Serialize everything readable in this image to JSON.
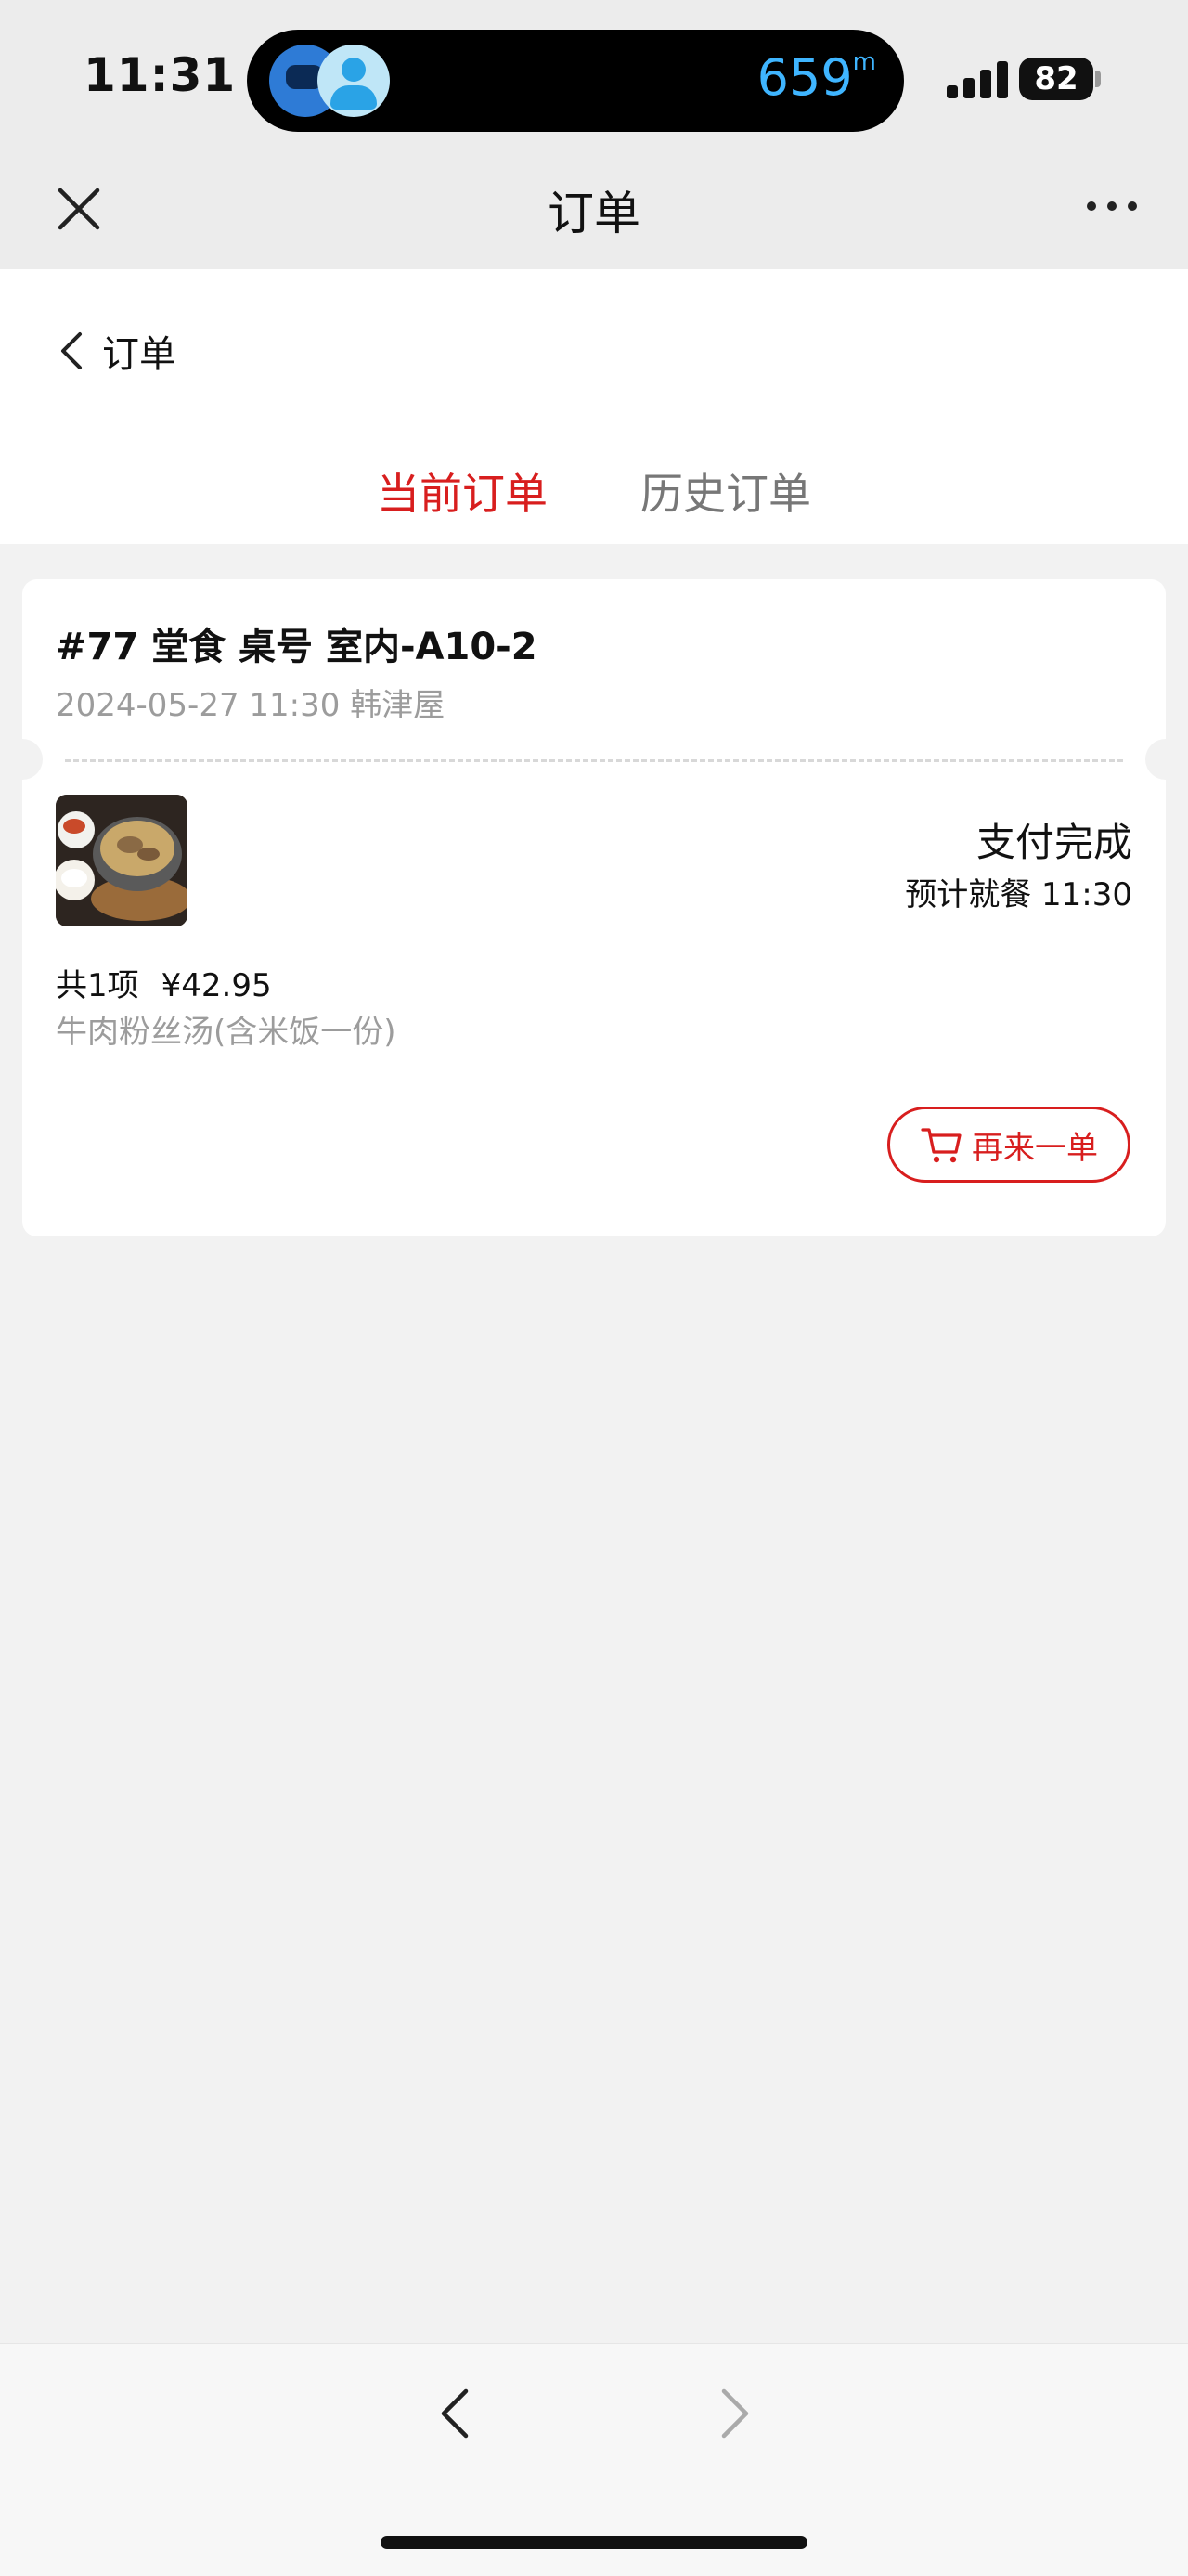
{
  "status_bar": {
    "time": "11:31",
    "distance_value": "659",
    "distance_unit": "m",
    "battery": "82"
  },
  "nav_bar": {
    "title": "订单",
    "close_icon": "close-icon",
    "more_icon": "more-icon"
  },
  "page": {
    "back_label": "订单",
    "tabs": [
      {
        "label": "当前订单",
        "active": true
      },
      {
        "label": "历史订单",
        "active": false
      }
    ]
  },
  "order": {
    "header": "#77 堂食 桌号 室内-A10-2",
    "datetime": "2024-05-27 11:30",
    "store": "韩津屋",
    "status": "支付完成",
    "eta": "预计就餐 11:30",
    "item_count": "共1项",
    "total": "¥42.95",
    "item_name": "牛肉粉丝汤(含米饭一份)",
    "reorder_label": "再来一单"
  },
  "colors": {
    "accent": "#d81e1e",
    "muted_text": "#9c9c9c",
    "page_bg": "#f2f2f2",
    "distance": "#3fb5ff"
  }
}
